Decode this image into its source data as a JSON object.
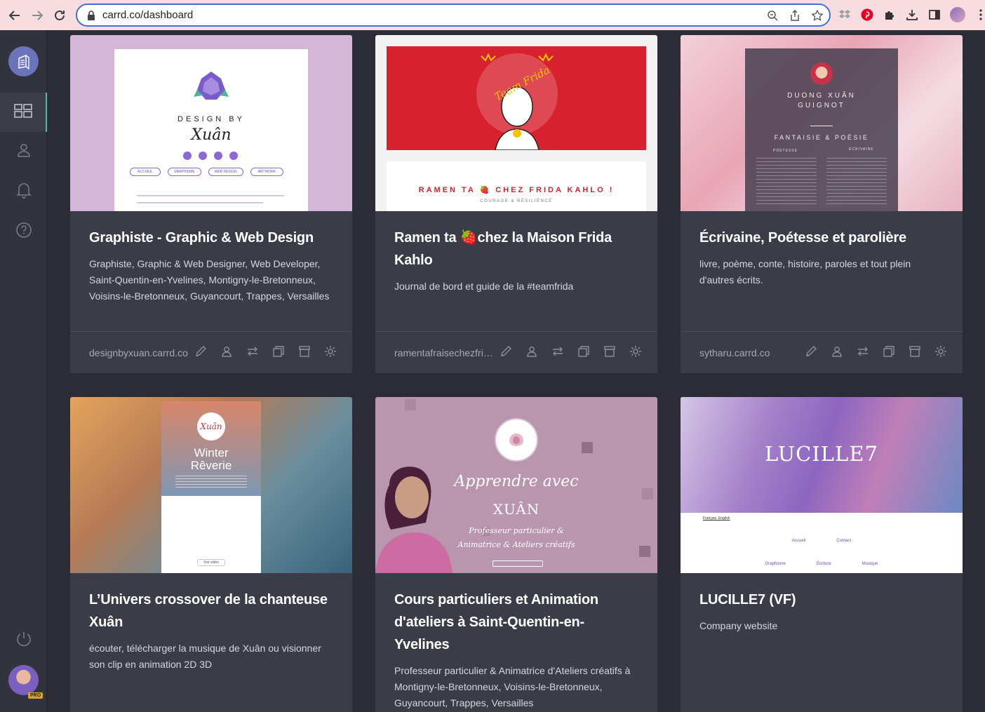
{
  "browser": {
    "url": "carrd.co/dashboard"
  },
  "colors": {
    "accent": "#35c3a6",
    "sidebar_bg": "#31333d",
    "main_bg": "#2b2c35",
    "card_bg": "#3a3c47"
  },
  "sidebar": {
    "items": [
      {
        "icon": "grid-icon",
        "active": true
      },
      {
        "icon": "users-icon",
        "active": false
      },
      {
        "icon": "bell-icon",
        "active": false
      },
      {
        "icon": "help-icon",
        "active": false
      }
    ],
    "bottom": {
      "icon": "power-icon"
    },
    "badge": "PRO"
  },
  "cards": [
    {
      "title": "Graphiste - Graphic & Web Design",
      "description": "Graphiste, Graphic & Web Designer, Web Developer, Saint-Quentin-en-Yvelines, Montigny-le-Bretonneux, Voisins-le-Bretonneux, Guyancourt, Trappes, Versailles",
      "url": "designbyxuan.carrd.co",
      "thumb": {
        "heading": "DESIGN BY",
        "name": "Xuân",
        "nav": [
          "ACCUEIL",
          "GRAPHISME",
          "WEB DESIGN",
          "ARTWORK"
        ]
      }
    },
    {
      "title": "Ramen ta 🍓chez la Maison Frida Kahlo",
      "description": "Journal de bord et guide de la #teamfrida",
      "url": "ramentafraisechezfrid…",
      "thumb": {
        "heading": "RAMEN TA 🍓 CHEZ FRIDA KAHLO !",
        "subheading": "COURAGE & RÉSILIENCE",
        "art_text": "Team Frida"
      }
    },
    {
      "title": "Écrivaine, Poétesse et parolière",
      "description": "livre, poème, conte, histoire, paroles et tout plein d'autres écrits.",
      "url": "sytharu.carrd.co",
      "thumb": {
        "name_line1": "DUONG XUÂN",
        "name_line2": "GUIGNOT",
        "tagline": "FANTAISIE & POÉSIE",
        "col1": "POÉTESSE",
        "col2": "ÉCRIVAINE"
      }
    },
    {
      "title": "L’Univers crossover de la chanteuse Xuân",
      "description": "écouter, télécharger la musique de Xuân ou visionner son clip en animation 2D 3D",
      "thumb": {
        "logo": "Xuân",
        "title_line1": "Winter",
        "title_line2": "Rêverie",
        "button": "Voir vidéo"
      }
    },
    {
      "title": "Cours particuliers et Animation d'ateliers à Saint-Quentin-en-Yvelines",
      "description": "Professeur particulier & Animatrice d'Ateliers créatifs à Montigny-le-Bretonneux, Voisins-le-Bretonneux, Guyancourt, Trappes, Versailles",
      "thumb": {
        "line1": "Apprendre avec",
        "line2": "XUÂN",
        "line3": "Professeur particulier &",
        "line4": "Animatrice & Ateliers créatifs"
      }
    },
    {
      "title": "LUCILLE7 (VF)",
      "description": "Company website",
      "thumb": {
        "logo": "LUCILLE7",
        "lang": "Français  English",
        "nav_row1": [
          "Accueil",
          "Contact"
        ],
        "nav_row2": [
          "Graphisme",
          "Écriture",
          "Musique"
        ]
      }
    }
  ]
}
